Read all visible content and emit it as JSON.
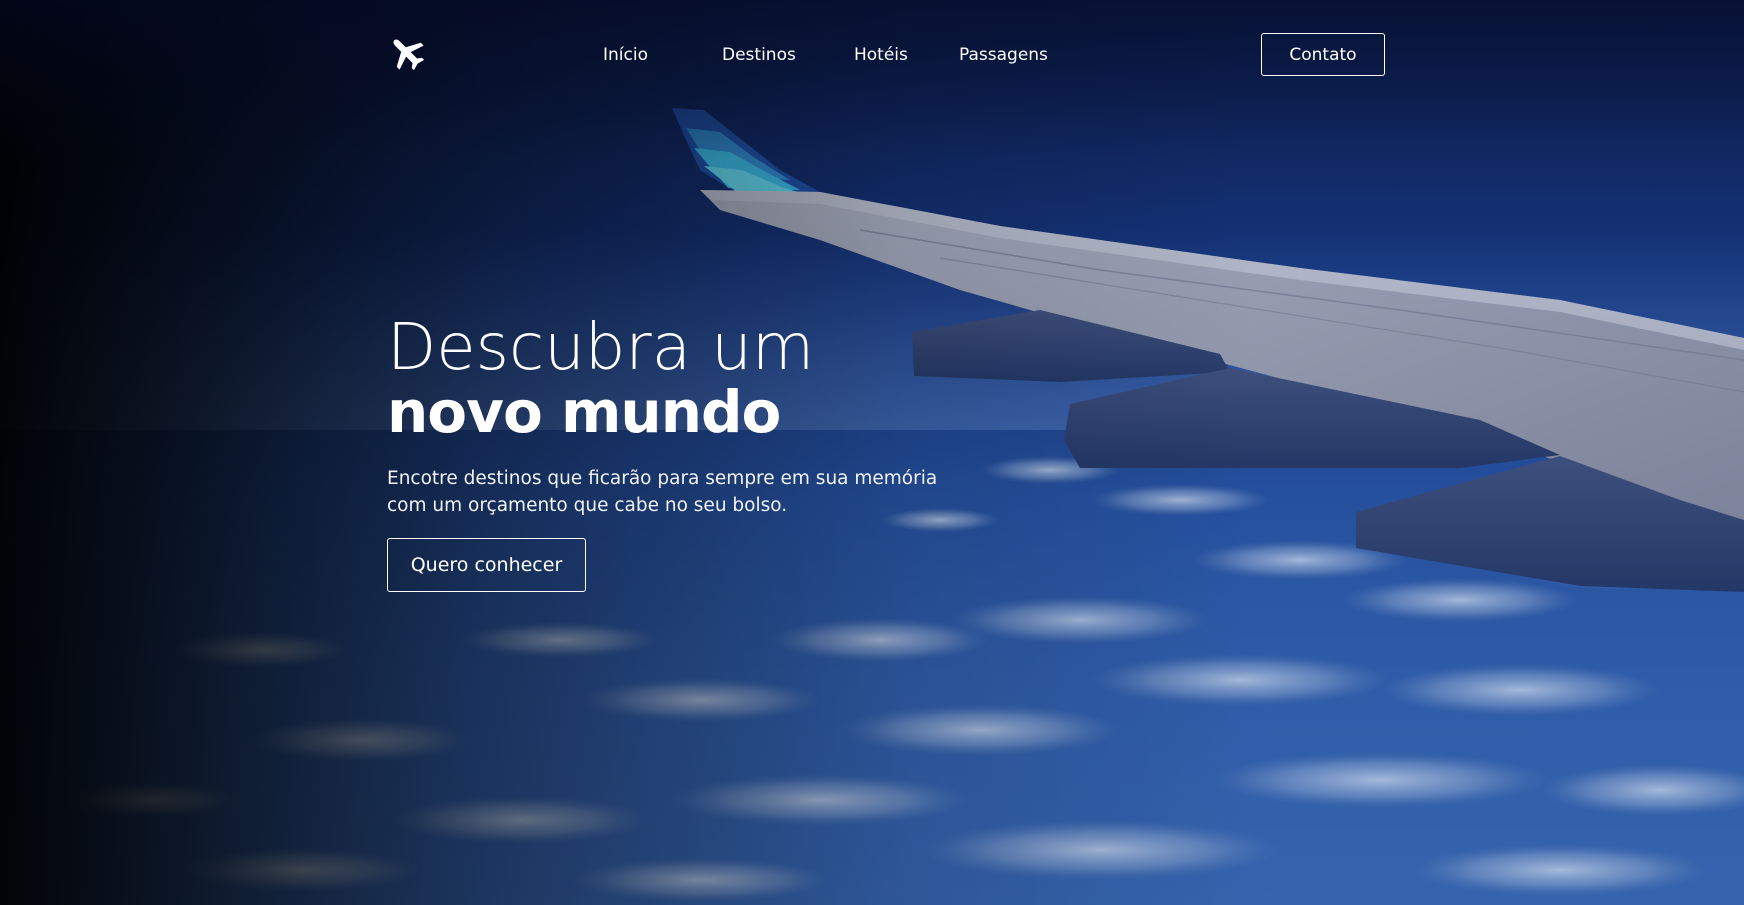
{
  "brand": {
    "logo_icon": "airplane-icon"
  },
  "nav": {
    "links": [
      {
        "label": "Início"
      },
      {
        "label": "Destinos"
      },
      {
        "label": "Hotéis"
      },
      {
        "label": "Passagens"
      }
    ],
    "contact_label": "Contato"
  },
  "hero": {
    "title_line1": "Descubra um",
    "title_line2": "novo mundo",
    "subtitle_line1": "Encotre destinos que ficarão para sempre em sua memória",
    "subtitle_line2": "com um orçamento que cabe no seu bolso.",
    "cta_label": "Quero conhecer",
    "background_image": "airplane-wing-over-clouds"
  },
  "colors": {
    "text": "#ffffff",
    "sky_top": "#0b1a44",
    "sky_bottom": "#3563ad",
    "wing": "#8f97ad",
    "winglet_accent": "#3aa7d8"
  }
}
